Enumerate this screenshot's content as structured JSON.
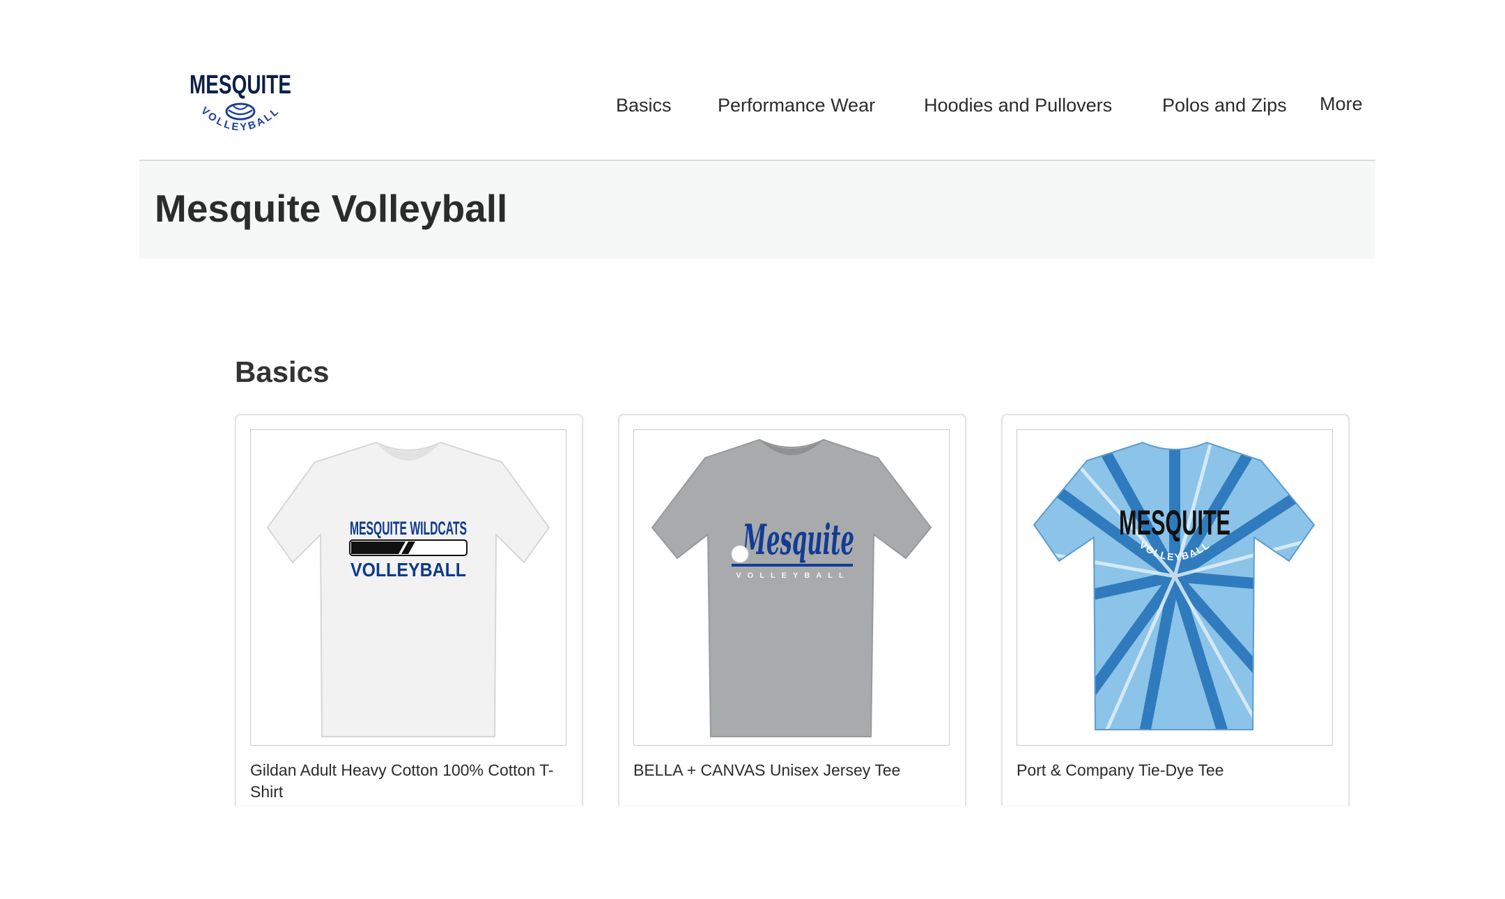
{
  "header": {
    "logo": {
      "wordmark": "MESQUITE",
      "sub": "VOLLEYBALL",
      "icon": "volleyball-icon"
    },
    "nav": [
      {
        "label": "Basics"
      },
      {
        "label": "Performance Wear"
      },
      {
        "label": "Hoodies and Pullovers"
      },
      {
        "label": "Polos and Zips"
      },
      {
        "label": "More"
      }
    ]
  },
  "banner": {
    "title": "Mesquite Volleyball"
  },
  "section": {
    "title": "Basics"
  },
  "products": [
    {
      "name": "Gildan Adult Heavy Cotton 100% Cotton T-Shirt",
      "shirt_color": "#f2f2f2",
      "print_line1": "MESQUITE WILDCATS",
      "print_line2": "VOLLEYBALL"
    },
    {
      "name": "BELLA + CANVAS Unisex Jersey Tee",
      "shirt_color": "#a9aaab",
      "print_script": "Mesquite",
      "print_sub": "VOLLEYBALL"
    },
    {
      "name": "Port & Company Tie-Dye Tee",
      "shirt_color": "#5fa3d6",
      "print_line1": "MESQUITE",
      "print_sub": "VOLLEYBALL"
    }
  ],
  "colors": {
    "brand_navy": "#0b1f4a",
    "brand_blue": "#1e3f9a",
    "banner_bg": "#f6f7f7",
    "divider": "#d9dadb"
  }
}
